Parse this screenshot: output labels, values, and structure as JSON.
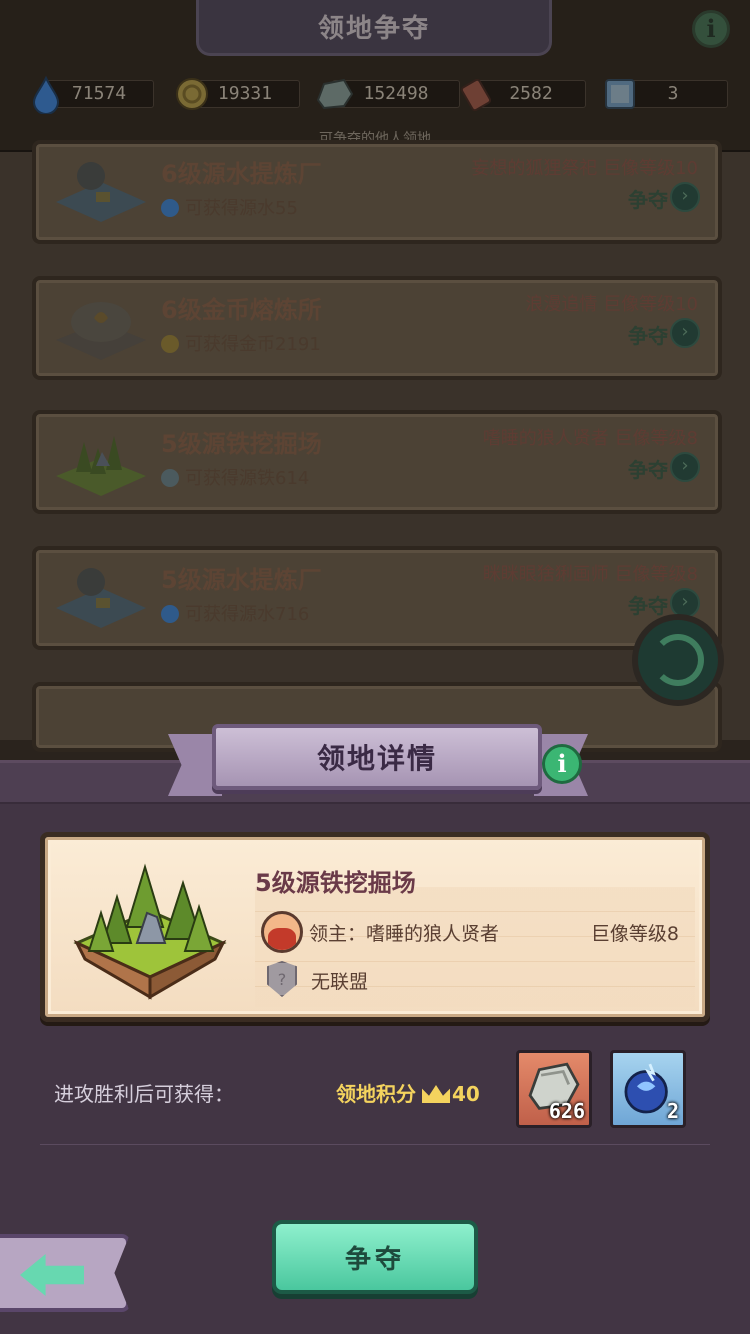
{
  "header": {
    "title": "领地争夺",
    "subtitle": "可争夺的他人领地",
    "info_label": "i",
    "resources": [
      {
        "icon": "water-drop-icon",
        "value": "71574"
      },
      {
        "icon": "gold-coin-icon",
        "value": "19331"
      },
      {
        "icon": "iron-ore-icon",
        "value": "152498"
      },
      {
        "icon": "scroll-icon",
        "value": "2582"
      },
      {
        "icon": "ticket-icon",
        "value": "3"
      }
    ]
  },
  "territory_list": [
    {
      "name": "6级源水提炼厂",
      "owner": "妄想的狐狸祭祀  巨像等级10",
      "gain": "可获得源水55",
      "action": "争夺",
      "gain_color": "#2f5a8a"
    },
    {
      "name": "6级金币熔炼所",
      "owner": "浪漫追情  巨像等级10",
      "gain": "可获得金币2191",
      "action": "争夺",
      "gain_color": "#6a5a2a"
    },
    {
      "name": "5级源铁挖掘场",
      "owner": "嗜睡的狼人贤者  巨像等级8",
      "gain": "可获得源铁614",
      "action": "争夺",
      "gain_color": "#4b5a5e"
    },
    {
      "name": "5级源水提炼厂",
      "owner": "眯眯眼猞猁画师  巨像等级8",
      "gain": "可获得源水716",
      "action": "争夺",
      "gain_color": "#2f5a8a"
    }
  ],
  "modal": {
    "title": "领地详情",
    "info_label": "i",
    "territory_name": "5级源铁挖掘场",
    "lord_label": "领主：嗜睡的狼人贤者",
    "colossus_level": "巨像等级8",
    "alliance_icon_label": "?",
    "alliance": "无联盟",
    "reward_label": "进攻胜利后可获得：",
    "score_label": "领地积分",
    "score_value": "40",
    "rewards": [
      {
        "icon": "iron-ore-icon",
        "quantity": "626"
      },
      {
        "icon": "blue-orb-icon",
        "quantity": "2"
      }
    ],
    "fight_button": "争夺"
  },
  "colors": {
    "accent_green": "#4ac79e",
    "gold": "#f4d35e",
    "modal_bg": "#423544",
    "card_bg": "#fbecd6"
  }
}
